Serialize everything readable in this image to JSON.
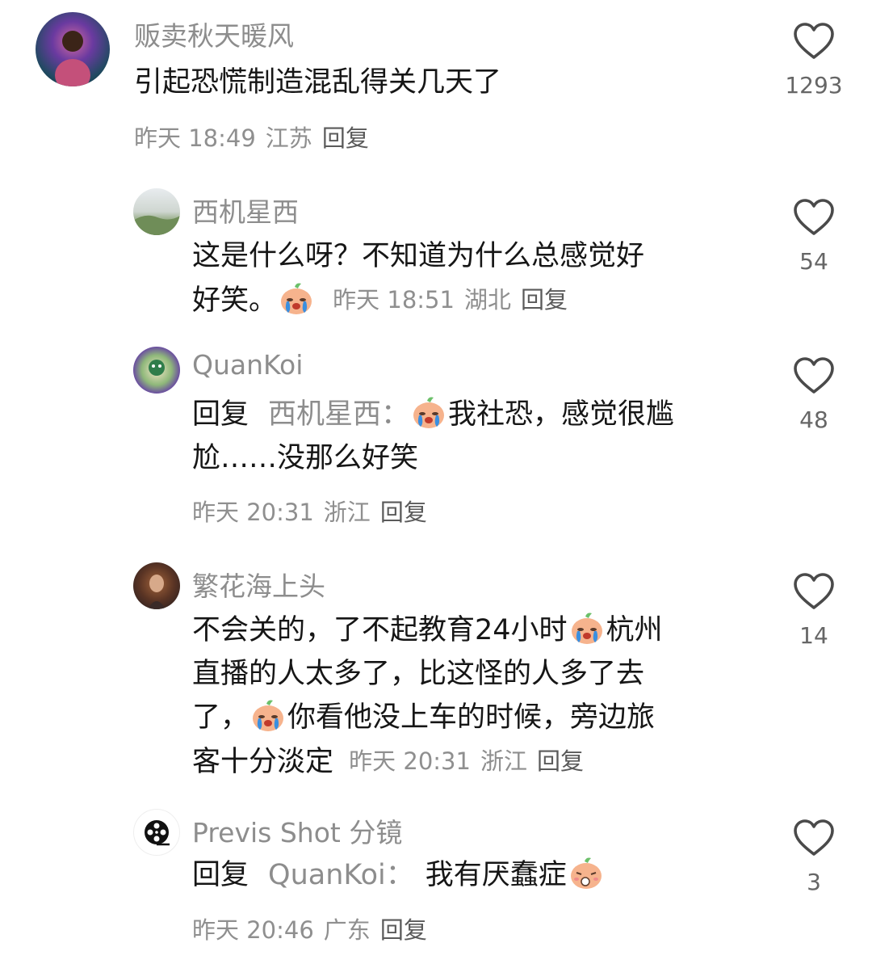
{
  "comments": [
    {
      "username": "贩卖秋天暖风",
      "text": "引起恐慌制造混乱得关几天了",
      "time": "昨天 18:49",
      "location": "江苏",
      "reply_label": "回复",
      "likes": "1293"
    },
    {
      "username": "西机星西",
      "text_line1": "这是什么呀？不知道为什么总感觉好",
      "text_line2": "好笑。",
      "time": "昨天 18:51",
      "location": "湖北",
      "reply_label": "回复",
      "likes": "54"
    },
    {
      "username": "QuanKoi",
      "reply_prefix": "回复",
      "reply_target": "西机星西：",
      "text_line1": "我社恐，感觉很尴",
      "text_line2": "尬……没那么好笑",
      "time": "昨天 20:31",
      "location": "浙江",
      "reply_label": "回复",
      "likes": "48"
    },
    {
      "username": "繁花海上头",
      "text_line1a": "不会关的，了不起教育24小时",
      "text_line1b": "杭州",
      "text_line2": "直播的人太多了，比这怪的人多了去",
      "text_line3a": "了，",
      "text_line3b": "你看他没上车的时候，旁边旅",
      "text_line4": "客十分淡定",
      "time": "昨天 20:31",
      "location": "浙江",
      "reply_label": "回复",
      "likes": "14"
    },
    {
      "username": "Previs Shot 分镜",
      "reply_prefix": "回复",
      "reply_target": "QuanKoi：",
      "text": "我有厌蠢症",
      "time": "昨天 20:46",
      "location": "广东",
      "reply_label": "回复",
      "likes": "3"
    }
  ],
  "colors": {
    "text": "#161616",
    "secondary": "#8d8d8d",
    "reply_link": "#5a5a5a"
  }
}
